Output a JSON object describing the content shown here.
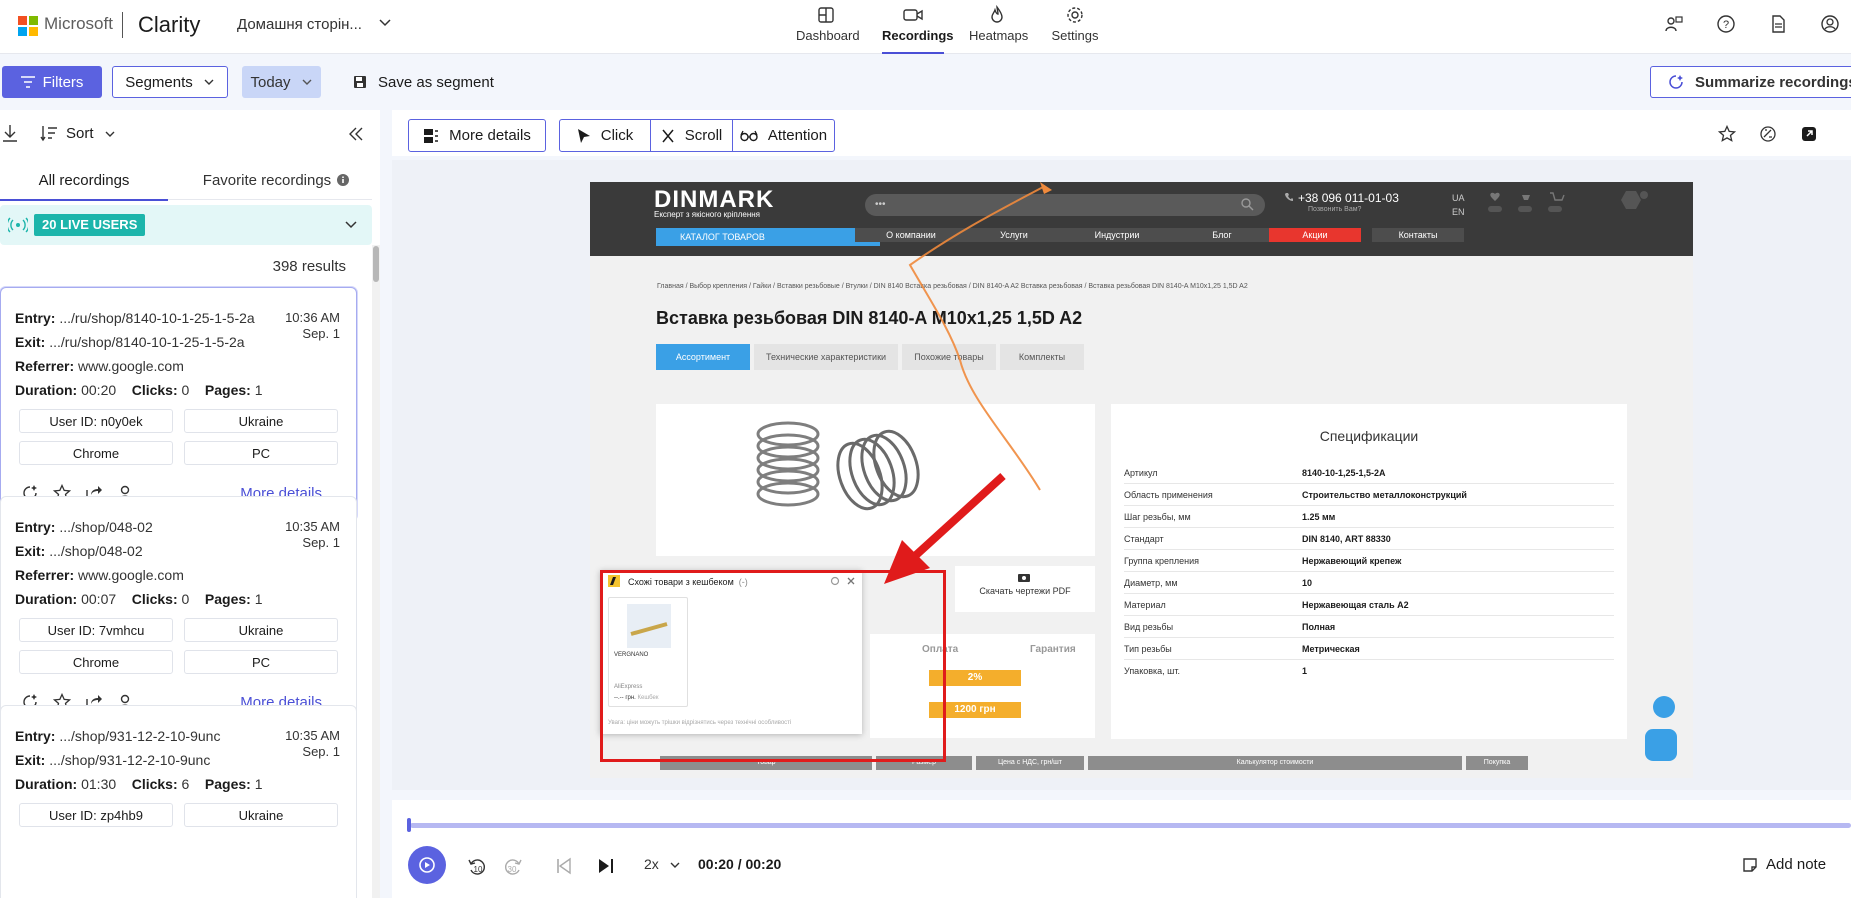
{
  "header": {
    "ms_name": "Microsoft",
    "app_name": "Clarity",
    "project": "Домашня сторін...",
    "nav": [
      {
        "label": "Dashboard",
        "icon": "dashboard-icon"
      },
      {
        "label": "Recordings",
        "icon": "video-icon"
      },
      {
        "label": "Heatmaps",
        "icon": "flame-icon"
      },
      {
        "label": "Settings",
        "icon": "gear-icon"
      }
    ],
    "brand_colors": [
      "#f25022",
      "#7fba00",
      "#00a4ef",
      "#ffb900"
    ],
    "accent": "#5b62e0"
  },
  "toolbar": {
    "filters": "Filters",
    "segments": "Segments",
    "date": "Today",
    "save_segment": "Save as segment",
    "summarize": "Summarize recordings"
  },
  "list": {
    "sort": "Sort",
    "tab_all": "All recordings",
    "tab_fav": "Favorite recordings",
    "live": "20 LIVE USERS",
    "results": "398 results",
    "labels": {
      "entry": "Entry:",
      "exit": "Exit:",
      "referrer": "Referrer:",
      "duration": "Duration:",
      "clicks": "Clicks:",
      "pages": "Pages:",
      "user_id": "User ID:",
      "more": "More details"
    },
    "cards": [
      {
        "entry": ".../ru/shop/8140-10-1-25-1-5-2a",
        "exit": ".../ru/shop/8140-10-1-25-1-5-2a",
        "referrer": "www.google.com",
        "duration": "00:20",
        "clicks": "0",
        "pages": "1",
        "time": "10:36 AM",
        "date": "Sep. 1",
        "user_id": "n0y0ek",
        "country": "Ukraine",
        "browser": "Chrome",
        "device": "PC"
      },
      {
        "entry": ".../shop/048-02",
        "exit": ".../shop/048-02",
        "referrer": "www.google.com",
        "duration": "00:07",
        "clicks": "0",
        "pages": "1",
        "time": "10:35 AM",
        "date": "Sep. 1",
        "user_id": "7vmhcu",
        "country": "Ukraine",
        "browser": "Chrome",
        "device": "PC"
      },
      {
        "entry": ".../shop/931-12-2-10-9unc",
        "exit": ".../shop/931-12-2-10-9unc",
        "duration": "01:30",
        "clicks": "6",
        "pages": "1",
        "time": "10:35 AM",
        "date": "Sep. 1",
        "user_id": "zp4hb9",
        "country": "Ukraine"
      }
    ]
  },
  "player": {
    "more_details": "More details",
    "click": "Click",
    "scroll": "Scroll",
    "attention": "Attention",
    "speed": "2x",
    "timecode": "00:20 / 00:20",
    "add_note": "Add note",
    "progress": 1.0
  },
  "site": {
    "logo": "DINMARK",
    "logo_sub": "Експерт з якісного кріплення",
    "search_placeholder": "•••",
    "phone": "+38 096 011-01-03",
    "phone_sub": "Позвонить Вам?",
    "lang": [
      "UA",
      "EN"
    ],
    "catalog": "КАТАЛОГ ТОВАРОВ",
    "menu": [
      "О компании",
      "Услуги",
      "Индустрии",
      "Блог",
      "Акции",
      "Контакты"
    ],
    "breadcrumbs": "Главная / Выбор крепления / Гайки / Вставки резьбовые / Втулки / DIN 8140 Вставка резьбовая / DIN 8140-A A2 Вставка резьбовая / Вставка резьбовая DIN 8140-A M10x1,25 1,5D A2",
    "title": "Вставка резьбовая DIN 8140-A M10x1,25 1,5D A2",
    "tabs": [
      "Ассортимент",
      "Технические характеристики",
      "Похожие товары",
      "Комплекты"
    ],
    "spec_title": "Спецификации",
    "specs": [
      {
        "k": "Артикул",
        "v": "8140-10-1,25-1,5-2A"
      },
      {
        "k": "Область применения",
        "v": "Строительство металлоконструкций"
      },
      {
        "k": "Шаг резьбы, мм",
        "v": "1.25 мм"
      },
      {
        "k": "Стандарт",
        "v": "DIN 8140, ART 88330"
      },
      {
        "k": "Группа крепления",
        "v": "Нержавеющий крепеж"
      },
      {
        "k": "Диаметр, мм",
        "v": "10"
      },
      {
        "k": "Материал",
        "v": "Нержавеющая сталь A2"
      },
      {
        "k": "Вид резьбы",
        "v": "Полная"
      },
      {
        "k": "Тип резьбы",
        "v": "Метрическая"
      },
      {
        "k": "Упаковка, шт.",
        "v": "1"
      }
    ],
    "download": "Скачать чертежи PDF",
    "pay": "Оплата",
    "warranty": "Гарантия",
    "badge1": "2%",
    "badge2": "1200 грн",
    "table_heads": [
      "Товар",
      "Размер",
      "Цена с НДС, грн/шт",
      "Калькулятор стоимости",
      "Покупка"
    ],
    "popup_title": "Схожі товари з кешбеком",
    "popup_count": "(-)",
    "popup_item": "VERGNANO",
    "popup_store": "AliExpress",
    "popup_price": "грн.",
    "popup_cashback": "Кешбек",
    "popup_footer": "Увага: ціни можуть трішки відрізнятись через технічні особливості"
  }
}
